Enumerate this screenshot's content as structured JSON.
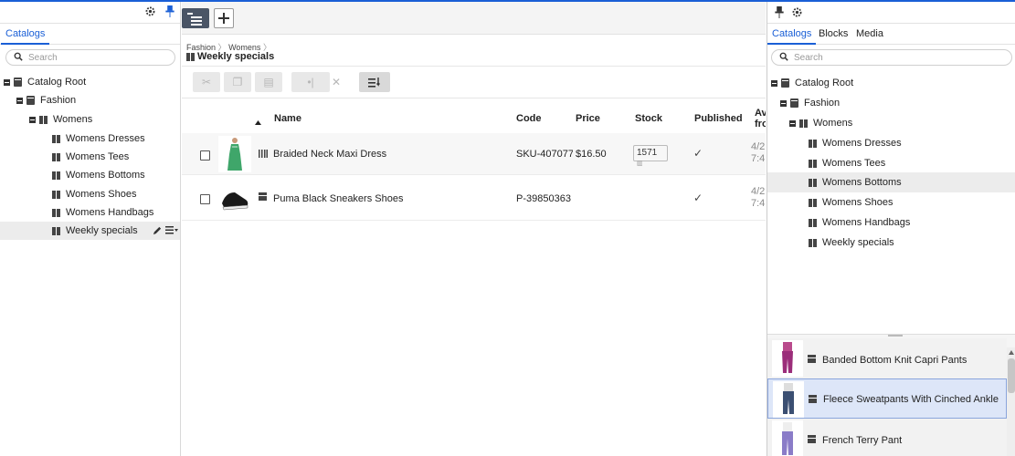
{
  "left_panel": {
    "tabs": [
      "Catalogs"
    ],
    "search_placeholder": "Search",
    "tree": [
      {
        "label": "Catalog Root"
      },
      {
        "label": "Fashion"
      },
      {
        "label": "Womens"
      },
      {
        "label": "Womens Dresses"
      },
      {
        "label": "Womens Tees"
      },
      {
        "label": "Womens Bottoms"
      },
      {
        "label": "Womens Shoes"
      },
      {
        "label": "Womens Handbags"
      },
      {
        "label": "Weekly specials"
      }
    ]
  },
  "main": {
    "breadcrumb": [
      "Fashion",
      "Womens"
    ],
    "title": "Weekly specials",
    "columns": {
      "name": "Name",
      "code": "Code",
      "price": "Price",
      "stock": "Stock",
      "published": "Published",
      "available": "Ava\nfro"
    },
    "rows": [
      {
        "name": "Braided Neck Maxi Dress",
        "code": "SKU-407077:",
        "price": "$16.50",
        "stock": "1571",
        "published": "✓",
        "available": "4/2\n7:4"
      },
      {
        "name": "Puma Black Sneakers Shoes",
        "code": "P-39850363",
        "price": "",
        "stock": "",
        "published": "✓",
        "available": "4/2\n7:4"
      }
    ]
  },
  "right_panel": {
    "tabs": [
      "Catalogs",
      "Blocks",
      "Media"
    ],
    "search_placeholder": "Search",
    "tree": [
      {
        "label": "Catalog Root"
      },
      {
        "label": "Fashion"
      },
      {
        "label": "Womens"
      },
      {
        "label": "Womens Dresses"
      },
      {
        "label": "Womens Tees"
      },
      {
        "label": "Womens Bottoms"
      },
      {
        "label": "Womens Shoes"
      },
      {
        "label": "Womens Handbags"
      },
      {
        "label": "Weekly specials"
      }
    ],
    "items": [
      {
        "label": "Banded Bottom Knit Capri Pants"
      },
      {
        "label": "Fleece Sweatpants With Cinched Ankle"
      },
      {
        "label": "French Terry Pant"
      }
    ]
  },
  "colors": {
    "accent": "#1a5fd6",
    "selected_bg": "#dde6f8"
  }
}
